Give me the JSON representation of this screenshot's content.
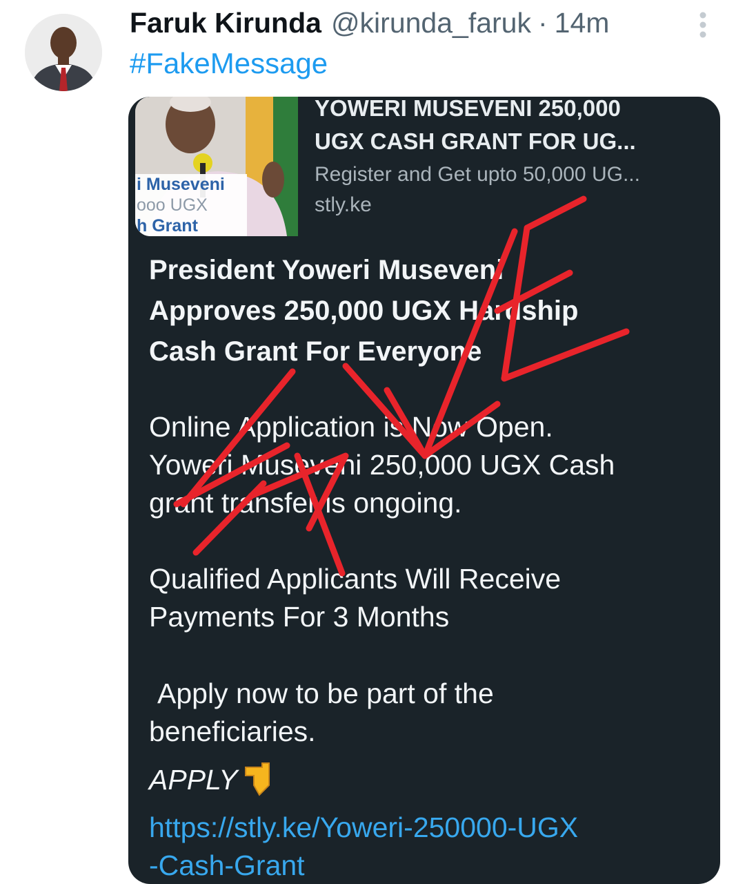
{
  "tweet": {
    "author_name": "Faruk Kirunda",
    "handle": "@kirunda_faruk",
    "separator": "·",
    "time_ago": "14m",
    "hashtag": "#FakeMessage",
    "more_icon": "vertical-ellipsis-icon",
    "avatar_icon": "person-avatar"
  },
  "screenshot": {
    "link_preview": {
      "thumb_text": [
        "i Museveni",
        "ooo UGX",
        "h Grant"
      ],
      "title_line1": "YOWERI MUSEVENI 250,000",
      "title_line2": "UGX CASH GRANT FOR UG...",
      "description": "Register and Get upto 50,000 UG...",
      "domain": "stly.ke"
    },
    "message": {
      "headline": [
        "President Yoweri Museveni",
        "Approves 250,000 UGX Hardship",
        "Cash Grant For Everyone"
      ],
      "para2": [
        "Online Application is Now Open.",
        "Yoweri Museveni 250,000 UGX Cash",
        "grant transfer is ongoing."
      ],
      "para3": [
        "Qualified Applicants Will Receive",
        "Payments For 3 Months"
      ],
      "para4": [
        "Apply now to be part of the",
        "beneficiaries."
      ],
      "apply_label": "APPLY",
      "apply_icon": "pointing-down-hand-icon",
      "link_line1": "https://stly.ke/Yoweri-250000-UGX",
      "link_line2": "-Cash-Grant"
    },
    "overlay_icon": "handwritten-fake-scrawl",
    "overlay_color": "#e8242b"
  },
  "colors": {
    "hashtag": "#1d9bf0",
    "card_bg": "#1a2329",
    "link": "#38a8ee"
  }
}
